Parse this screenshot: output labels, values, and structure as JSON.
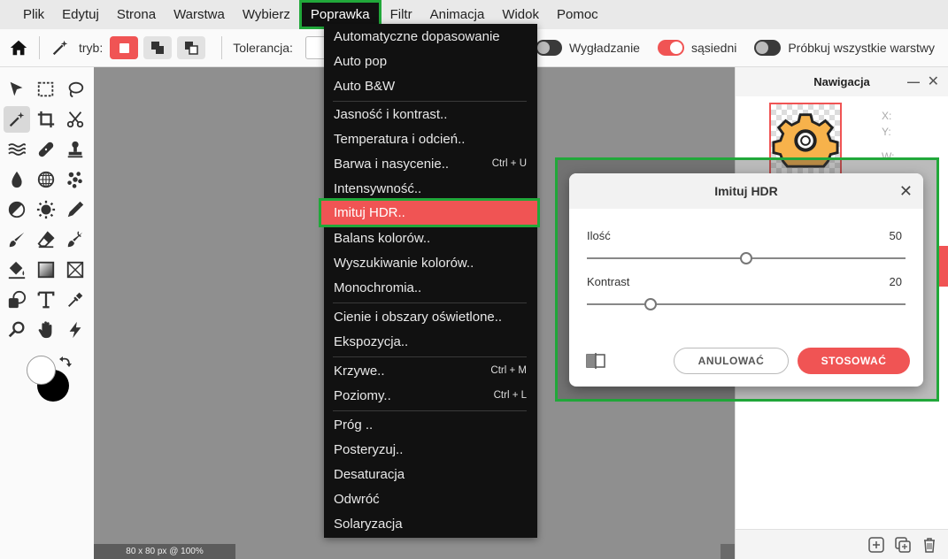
{
  "menubar": {
    "items": [
      "Plik",
      "Edytuj",
      "Strona",
      "Warstwa",
      "Wybierz",
      "Poprawka",
      "Filtr",
      "Animacja",
      "Widok",
      "Pomoc"
    ],
    "active": "Poprawka"
  },
  "toolbar": {
    "mode_label": "tryb:",
    "tolerance_label": "Tolerancja:",
    "smoothing_label": "Wygładzanie",
    "adjacent_label": "sąsiedni",
    "sample_all_label": "Próbkuj wszystkie warstwy",
    "smoothing_on": false,
    "adjacent_on": true,
    "sample_all_on": false
  },
  "tools": [
    "arrow-icon",
    "rect-select-icon",
    "lasso-icon",
    "magic-wand-icon",
    "crop-icon",
    "scissors-icon",
    "liquify-icon",
    "bandage-icon",
    "stamp-icon",
    "drop-icon",
    "sphere-icon",
    "scatter-icon",
    "dodge-icon",
    "sponge-icon",
    "color-picker-icon",
    "brush-icon",
    "eraser-icon",
    "mixer-brush-icon",
    "bucket-icon",
    "gradient-icon",
    "frame-icon",
    "shape-icon",
    "text-icon",
    "eyedropper-icon",
    "zoom-icon",
    "hand-icon",
    "lightning-icon"
  ],
  "dropdown": {
    "items": [
      {
        "label": "Automatyczne dopasowanie",
        "shortcut": ""
      },
      {
        "label": "Auto pop",
        "shortcut": ""
      },
      {
        "label": "Auto B&W",
        "shortcut": ""
      },
      {
        "label": "Jasność i kontrast..",
        "shortcut": ""
      },
      {
        "label": "Temperatura i odcień..",
        "shortcut": ""
      },
      {
        "label": "Barwa i nasycenie..",
        "shortcut": "Ctrl + U"
      },
      {
        "label": "Intensywność..",
        "shortcut": ""
      },
      {
        "label": "Imituj HDR..",
        "shortcut": ""
      },
      {
        "label": "Balans kolorów..",
        "shortcut": ""
      },
      {
        "label": "Wyszukiwanie kolorów..",
        "shortcut": ""
      },
      {
        "label": "Monochromia..",
        "shortcut": ""
      },
      {
        "label": "Cienie i obszary oświetlone..",
        "shortcut": ""
      },
      {
        "label": "Ekspozycja..",
        "shortcut": ""
      },
      {
        "label": "Krzywe..",
        "shortcut": "Ctrl + M"
      },
      {
        "label": "Poziomy..",
        "shortcut": "Ctrl + L"
      },
      {
        "label": "Próg ..",
        "shortcut": ""
      },
      {
        "label": "Posteryzuj..",
        "shortcut": ""
      },
      {
        "label": "Desaturacja",
        "shortcut": ""
      },
      {
        "label": "Odwróć",
        "shortcut": ""
      },
      {
        "label": "Solaryzacja",
        "shortcut": ""
      }
    ],
    "highlighted": "Imituj HDR.."
  },
  "navigator": {
    "title": "Nawigacja",
    "x_label": "X:",
    "y_label": "Y:",
    "w_label": "W:"
  },
  "canvas": {
    "status": "80 x 80 px @ 100%"
  },
  "dialog": {
    "title": "Imituj HDR",
    "amount_label": "Ilość",
    "amount_value": "50",
    "amount_fraction": 0.5,
    "contrast_label": "Kontrast",
    "contrast_value": "20",
    "contrast_fraction": 0.2,
    "cancel_label": "ANULOWAĆ",
    "apply_label": "STOSOWAĆ"
  },
  "colors": {
    "accent": "#f05454",
    "highlight_frame": "#21a83a",
    "menu_bg": "#111111"
  }
}
